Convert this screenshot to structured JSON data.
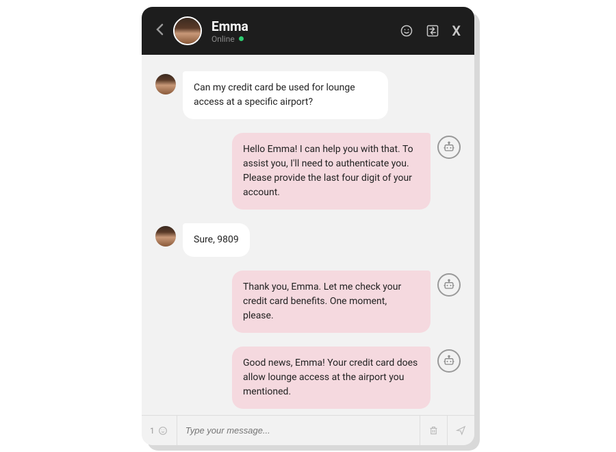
{
  "header": {
    "name": "Emma",
    "status": "Online"
  },
  "messages": [
    {
      "sender": "user",
      "text": "Can my credit card be used for lounge access at a specific airport?"
    },
    {
      "sender": "bot",
      "text": "Hello Emma! I can help you with that. To assist you, I'll need to authenticate you. Please provide the last four digit of your account."
    },
    {
      "sender": "user",
      "text": "Sure, 9809"
    },
    {
      "sender": "bot",
      "text": "Thank you, Emma. Let me check your credit card benefits. One moment, please."
    },
    {
      "sender": "bot",
      "text": "Good news, Emma! Your credit card does allow lounge access at the airport you mentioned."
    }
  ],
  "input": {
    "attach_count": "1",
    "placeholder": "Type your message..."
  }
}
